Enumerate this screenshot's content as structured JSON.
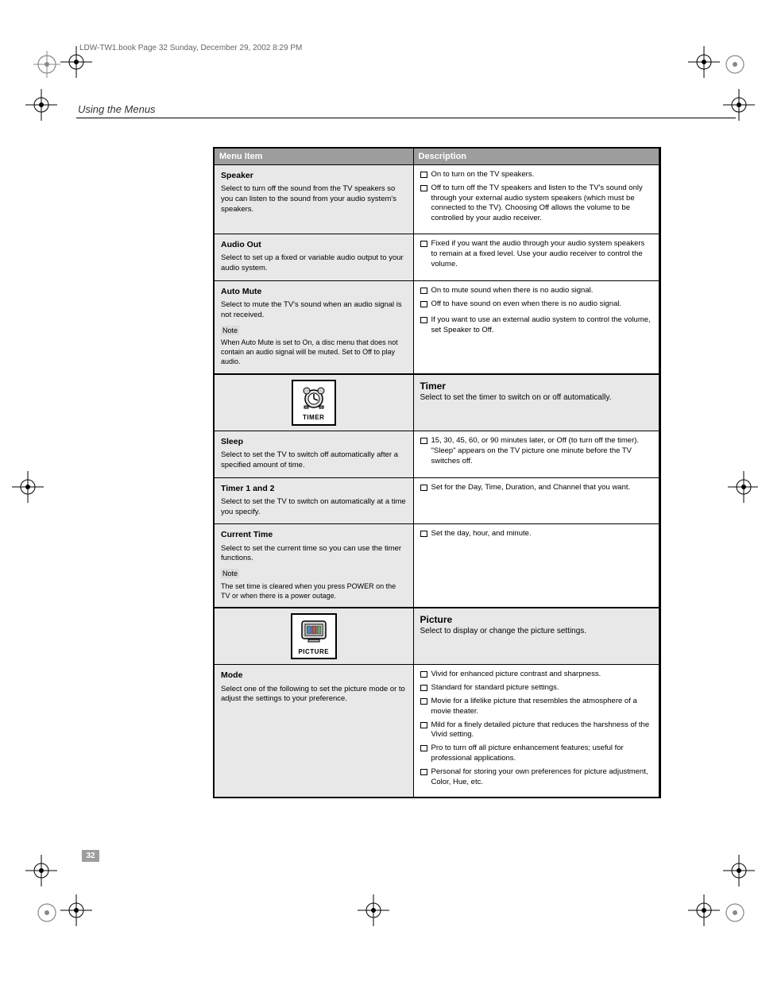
{
  "header_date": "LDW-TW1.book  Page 32  Sunday, December 29, 2002  8:29 PM",
  "running_head": "Using the Menus",
  "page_number": "32",
  "cols": {
    "menu_item": "Menu Item",
    "description": "Description"
  },
  "rows": [
    {
      "title": "Speaker",
      "expl": "Select to turn off the sound from the TV speakers so you can listen to the sound from your audio system's speakers.",
      "bullets": [
        "On to turn on the TV speakers.",
        "Off to turn off the TV speakers and listen to the TV's sound only through your external audio system speakers (which must be connected to the TV). Choosing Off allows the volume to be controlled by your audio receiver."
      ]
    },
    {
      "title": "Audio Out",
      "expl": "Select to set up a fixed or variable audio output to your audio system.",
      "bullets": [
        "Fixed if you want the audio through your audio system speakers to remain at a fixed level. Use your audio receiver to control the volume."
      ]
    },
    {
      "title": "Auto Mute",
      "expl": "Select to mute the TV's sound when an audio signal is not received.",
      "bullets": [
        "On to mute sound when there is no audio signal.",
        "Off to have sound on even when there is no audio signal."
      ],
      "extra_bullets": [
        "If you want to use an external audio system to control the volume, set Speaker to Off."
      ],
      "note_label": "Note",
      "note_body": "When Auto Mute is set to On, a disc menu that does not contain an audio signal will be muted. Set to Off to play audio."
    }
  ],
  "timer": {
    "icon_caption": "TIMER",
    "title": "Timer",
    "sub": "Select to set the timer to switch on or off automatically.",
    "rows": [
      {
        "title": "Sleep",
        "expl": "Select to set the TV to switch off automatically after a specified amount of time.",
        "bullets": [
          "15, 30, 45, 60, or 90 minutes later, or Off (to turn off the timer). \"Sleep\" appears on the TV picture one minute before the TV switches off."
        ]
      },
      {
        "title": "Timer 1 and 2",
        "expl": "Select to set the TV to switch on automatically at a time you specify.",
        "bullets": [
          "Set for the Day, Time, Duration, and Channel that you want."
        ]
      },
      {
        "title": "Current Time",
        "expl": "Select to set the current time so you can use the timer functions.",
        "bullets": [
          "Set the day, hour, and minute."
        ],
        "note_label": "Note",
        "note_body": "The set time is cleared when you press POWER on the TV or when there is a power outage."
      }
    ]
  },
  "picture": {
    "icon_caption": "PICTURE",
    "title": "Picture",
    "sub": "Select to display or change the picture settings.",
    "rows": [
      {
        "title": "Mode",
        "expl": "Select one of the following to set the picture mode or to adjust the settings to your preference.",
        "bullets": [
          "Vivid for enhanced picture contrast and sharpness.",
          "Standard for standard picture settings.",
          "Movie for a lifelike picture that resembles the atmosphere of a movie theater.",
          "Mild for a finely detailed picture that reduces the harshness of the Vivid setting.",
          "Pro to turn off all picture enhancement features; useful for professional applications.",
          "Personal for storing your own preferences for picture adjustment, Color, Hue, etc."
        ]
      }
    ]
  }
}
